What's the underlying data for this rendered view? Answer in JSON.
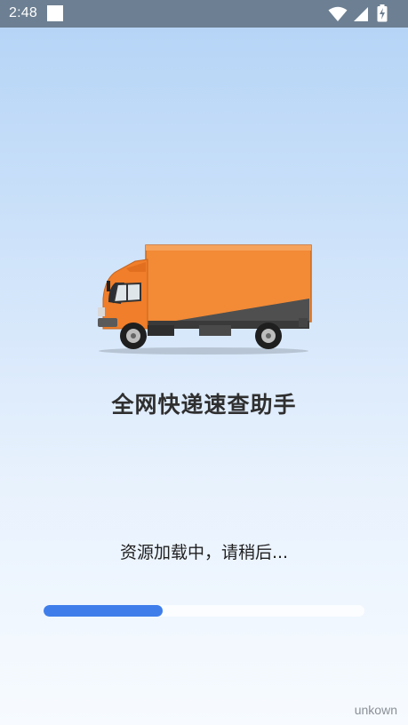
{
  "status_bar": {
    "time": "2:48",
    "icons": [
      "notification-square-icon",
      "wifi-icon",
      "cellular-signal-icon",
      "battery-charging-icon"
    ]
  },
  "app": {
    "title": "全网快递速查助手",
    "loading_text": "资源加载中，请稍后...",
    "progress": 0.37,
    "footer_label": "unkown"
  },
  "colors": {
    "progress_fill": "#3f7eea",
    "status_bar_bg": "#6d7f92",
    "truck_body": "#f28a36"
  }
}
